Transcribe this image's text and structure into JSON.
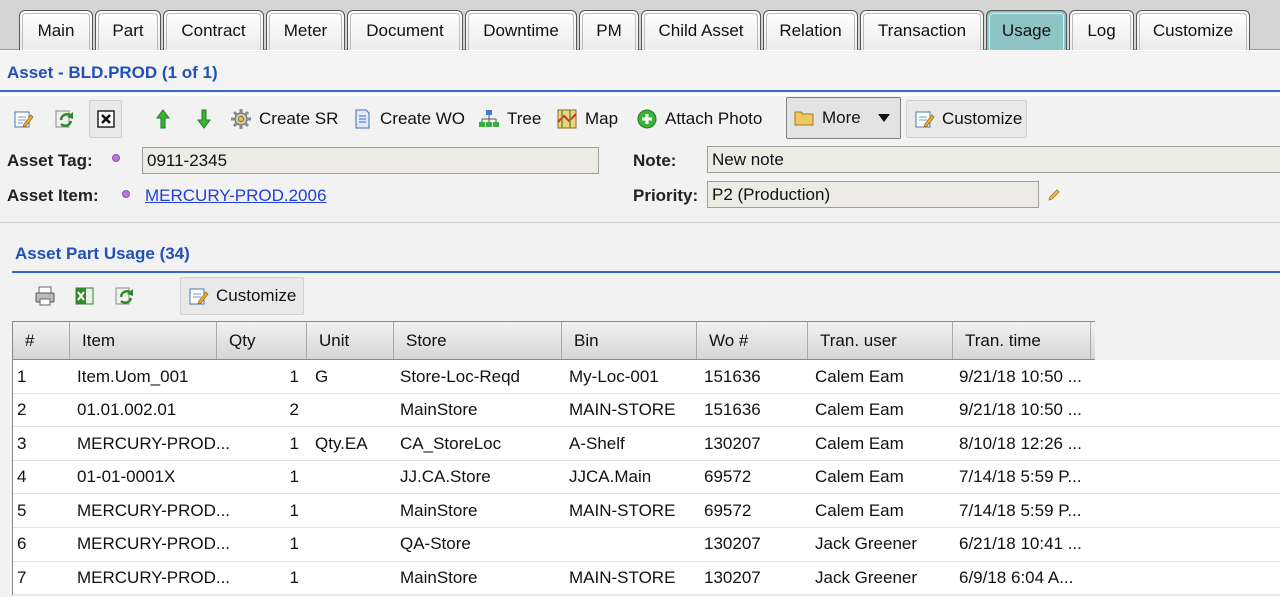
{
  "tabs": [
    {
      "label": "Main",
      "active": false
    },
    {
      "label": "Part",
      "active": false
    },
    {
      "label": "Contract",
      "active": false
    },
    {
      "label": "Meter",
      "active": false
    },
    {
      "label": "Document",
      "active": false
    },
    {
      "label": "Downtime",
      "active": false
    },
    {
      "label": "PM",
      "active": false
    },
    {
      "label": "Child Asset",
      "active": false
    },
    {
      "label": "Relation",
      "active": false
    },
    {
      "label": "Transaction",
      "active": false
    },
    {
      "label": "Usage",
      "active": true
    },
    {
      "label": "Log",
      "active": false
    },
    {
      "label": "Customize",
      "active": false
    }
  ],
  "asset": {
    "title": "Asset - BLD.PROD (1 of 1)"
  },
  "toolbar": {
    "icons": [
      "edit-icon",
      "refresh-icon",
      "close-icon",
      "arrow-up-icon",
      "arrow-down-icon"
    ],
    "create_sr": "Create SR",
    "create_wo": "Create WO",
    "tree": "Tree",
    "map": "Map",
    "attach_photo": "Attach Photo",
    "more": "More",
    "customize": "Customize"
  },
  "form": {
    "asset_tag_label": "Asset Tag:",
    "asset_tag_value": "0911-2345",
    "asset_item_label": "Asset Item:",
    "asset_item_value": "MERCURY-PROD.2006",
    "note_label": "Note:",
    "note_value": "New note",
    "priority_label": "Priority:",
    "priority_value": "P2 (Production)"
  },
  "usage": {
    "title": "Asset Part Usage (34)",
    "toolbar": {
      "icons": [
        "print-icon",
        "excel-icon",
        "refresh-icon"
      ],
      "customize": "Customize"
    },
    "columns": [
      "#",
      "Item",
      "Qty",
      "Unit",
      "Store",
      "Bin",
      "Wo #",
      "Tran. user",
      "Tran. time"
    ],
    "rows": [
      {
        "num": "1",
        "item": "Item.Uom_001",
        "qty": "1",
        "unit": "G",
        "store": "Store-Loc-Reqd",
        "bin": "My-Loc-001",
        "wo": "151636",
        "user": "Calem Eam",
        "time": "9/21/18 10:50 ..."
      },
      {
        "num": "2",
        "item": "01.01.002.01",
        "qty": "2",
        "unit": "",
        "store": "MainStore",
        "bin": "MAIN-STORE",
        "wo": "151636",
        "user": "Calem Eam",
        "time": "9/21/18 10:50 ..."
      },
      {
        "num": "3",
        "item": "MERCURY-PROD...",
        "qty": "1",
        "unit": "Qty.EA",
        "store": "CA_StoreLoc",
        "bin": "A-Shelf",
        "wo": "130207",
        "user": "Calem Eam",
        "time": "8/10/18 12:26 ..."
      },
      {
        "num": "4",
        "item": "01-01-0001X",
        "qty": "1",
        "unit": "",
        "store": "JJ.CA.Store",
        "bin": "JJCA.Main",
        "wo": "69572",
        "user": "Calem Eam",
        "time": "7/14/18 5:59 P..."
      },
      {
        "num": "5",
        "item": "MERCURY-PROD...",
        "qty": "1",
        "unit": "",
        "store": "MainStore",
        "bin": "MAIN-STORE",
        "wo": "69572",
        "user": "Calem Eam",
        "time": "7/14/18 5:59 P..."
      },
      {
        "num": "6",
        "item": "MERCURY-PROD...",
        "qty": "1",
        "unit": "",
        "store": "QA-Store",
        "bin": "",
        "wo": "130207",
        "user": "Jack Greener",
        "time": "6/21/18 10:41 ..."
      },
      {
        "num": "7",
        "item": "MERCURY-PROD...",
        "qty": "1",
        "unit": "",
        "store": "MainStore",
        "bin": "MAIN-STORE",
        "wo": "130207",
        "user": "Jack Greener",
        "time": "6/9/18 6:04 A..."
      }
    ]
  }
}
